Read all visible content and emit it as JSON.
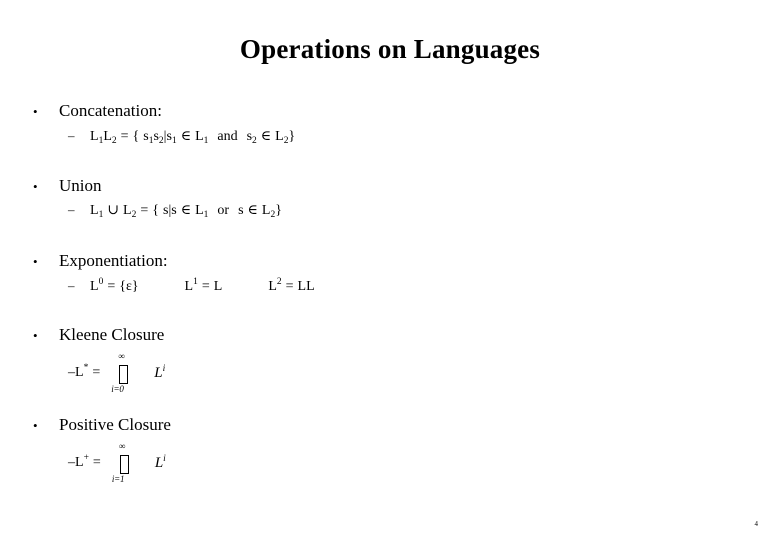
{
  "slide": {
    "title": "Operations on Languages",
    "background_color": "#ffffff",
    "text_color": "#000000",
    "page_number": "4",
    "bullet_marker": "•",
    "sub_bullet_marker": "–",
    "items": [
      {
        "heading": "Concatenation:",
        "sub": {
          "lhs_L": "L",
          "lhs_sub1": "1",
          "lhs_L2": "L",
          "lhs_sub2": "2",
          "eq": "=",
          "open_brace": "{",
          "s1": "s",
          "s1_sub": "1",
          "s2": "s",
          "s2_sub": "2",
          "bar": "|",
          "t1": "s",
          "t1_sub": "1",
          "in1": "∈",
          "set1": "L",
          "set1_sub": "1",
          "conj": "and",
          "t2": "s",
          "t2_sub": "2",
          "in2": "∈",
          "set2": "L",
          "set2_sub": "2",
          "close_brace": "}",
          "full_text": "L1L2 = { s1s2| s1 ∈ L1 and s2 ∈ L2}"
        }
      },
      {
        "heading": "Union",
        "sub": {
          "lhs_L": "L",
          "lhs_sub1": "1",
          "op": "∪",
          "lhs_L2": "L",
          "lhs_sub2": "2",
          "eq": "=",
          "open_brace": "{",
          "s": "s",
          "bar": "|",
          "t1": "s",
          "in1": "∈",
          "set1": "L",
          "set1_sub": "1",
          "conj": "or",
          "t2": "s",
          "in2": "∈",
          "set2": "L",
          "set2_sub": "2",
          "close_brace": "}",
          "full_text": "L1 ∪ L2 = { s| s ∈ L1 or  s ∈ L2}"
        }
      },
      {
        "heading": "Exponentiation:",
        "sub": {
          "expr1_base": "L",
          "expr1_sup": "0",
          "expr1_eq": "=",
          "expr1_rhs": "{ε}",
          "expr2_base": "L",
          "expr2_sup": "1",
          "expr2_eq": "=",
          "expr2_rhs": "L",
          "expr3_base": "L",
          "expr3_sup": "2",
          "expr3_eq": "=",
          "expr3_rhs": "LL",
          "full_text": "L0 = {ε}    L1 = L    L2 = LL"
        }
      },
      {
        "heading": "Kleene Closure",
        "sub": {
          "lhs_base": "L",
          "lhs_sup": "*",
          "eq": "=",
          "op_above": "∞",
          "op_below": "i=0",
          "term_base": "L",
          "term_sup": "i",
          "full_text": "L* = ∪(i=0 to ∞) Li"
        }
      },
      {
        "heading": "Positive Closure",
        "sub": {
          "lhs_base": "L",
          "lhs_sup": "+",
          "eq": "=",
          "op_above": "∞",
          "op_below": "i=1",
          "term_base": "L",
          "term_sup": "i",
          "full_text": "L+ = ∪(i=1 to ∞) Li"
        }
      }
    ]
  }
}
